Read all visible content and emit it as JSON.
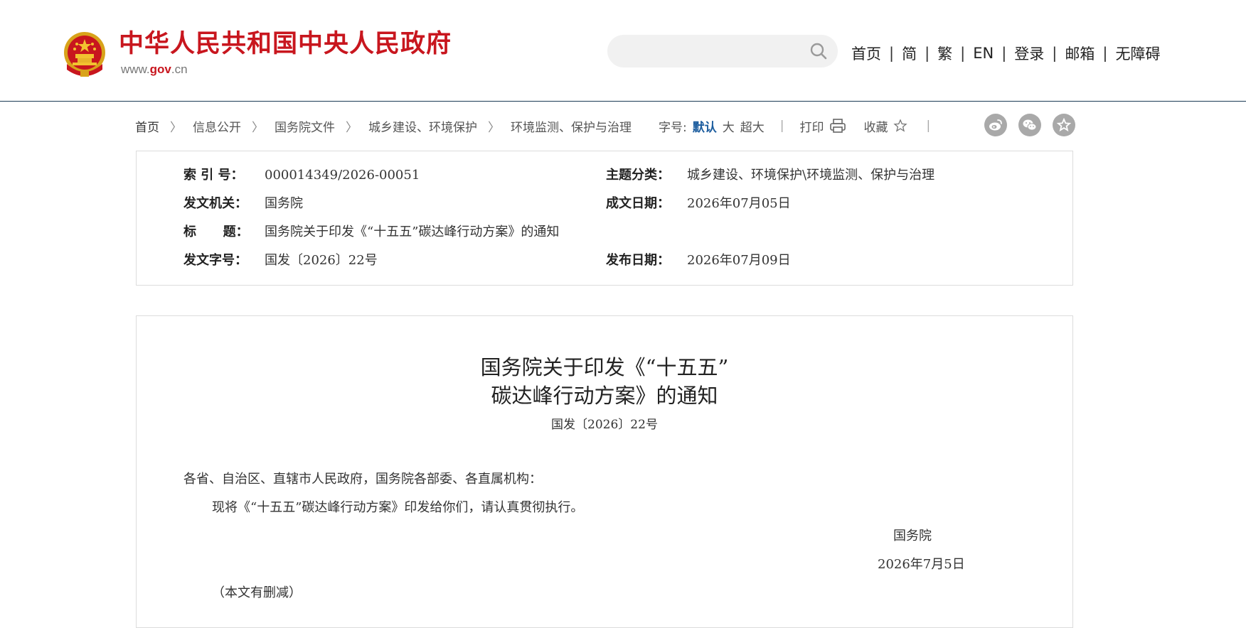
{
  "header": {
    "site_title": "中华人民共和国中央人民政府",
    "domain_prefix": "www.",
    "domain_main": "gov",
    "domain_suffix": ".cn",
    "search": {
      "placeholder": "",
      "icon": "search-icon"
    },
    "nav": [
      "首页",
      "简",
      "繁",
      "EN",
      "登录",
      "邮箱",
      "无障碍"
    ],
    "nav_separator": "|"
  },
  "breadcrumb": {
    "items": [
      "首页",
      "信息公开",
      "国务院文件",
      "城乡建设、环境保护",
      "环境监测、保护与治理"
    ],
    "separator": "〉"
  },
  "toolbar": {
    "font_size_label": "字号:",
    "font_sizes": [
      "默认",
      "大",
      "超大"
    ],
    "active_font_size": "默认",
    "divider": "|",
    "print_label": "打印",
    "favorite_label": "收藏",
    "share_icons": [
      "weibo-icon",
      "wechat-icon",
      "star-icon"
    ],
    "accent_color": "#1b5c9e"
  },
  "meta": {
    "index_no_label": "索 引 号：",
    "index_no": "000014349/2026-00051",
    "topic_label": "主题分类：",
    "topic": "城乡建设、环境保护\\环境监测、保护与治理",
    "issuer_label": "发文机关：",
    "issuer": "国务院",
    "written_date_label": "成文日期：",
    "written_date": "2026年07月05日",
    "title_label": "标      题：",
    "title": "国务院关于印发《“十五五”碳达峰行动方案》的通知",
    "doc_no_label": "发文字号：",
    "doc_no": "国发〔2026〕22号",
    "publish_date_label": "发布日期：",
    "publish_date": "2026年07月09日"
  },
  "article": {
    "title_line1": "国务院关于印发《“十五五”",
    "title_line2": "碳达峰行动方案》的通知",
    "doc_no": "国发〔2026〕22号",
    "salutation": "各省、自治区、直辖市人民政府，国务院各部委、各直属机构：",
    "body": "现将《“十五五”碳达峰行动方案》印发给你们，请认真贯彻执行。",
    "signature": "国务院",
    "date": "2026年7月5日",
    "note": "（本文有删减）"
  },
  "colors": {
    "brand_red": "#c8161e",
    "header_rule": "#1b3b55"
  }
}
